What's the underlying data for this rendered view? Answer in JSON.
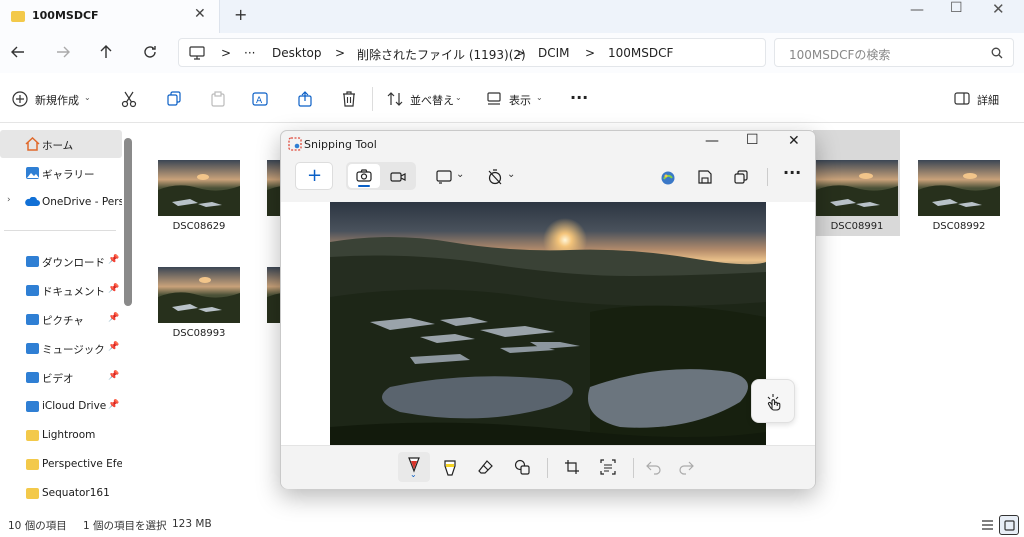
{
  "window": {
    "tab_title": "100MSDCF",
    "new_tab": "+"
  },
  "address": {
    "more": "···",
    "crumbs": [
      "Desktop",
      "削除されたファイル (1193)(2)",
      "DCIM",
      "100MSDCF"
    ],
    "separator": ">"
  },
  "search": {
    "placeholder": "100MSDCFの検索"
  },
  "toolbar": {
    "new_label": "新規作成",
    "sort_label": "並べ替え",
    "view_label": "表示",
    "more": "···",
    "details_label": "詳細"
  },
  "sidebar": {
    "home": "ホーム",
    "gallery": "ギャラリー",
    "onedrive": "OneDrive - Perso",
    "items": [
      {
        "label": "ダウンロード",
        "pinned": true
      },
      {
        "label": "ドキュメント",
        "pinned": true
      },
      {
        "label": "ピクチャ",
        "pinned": true
      },
      {
        "label": "ミュージック",
        "pinned": true
      },
      {
        "label": "ビデオ",
        "pinned": true
      },
      {
        "label": "iCloud Drive",
        "pinned": true
      },
      {
        "label": "Lightroom",
        "pinned": false
      },
      {
        "label": "Perspective Efex",
        "pinned": false
      },
      {
        "label": "Sequator161",
        "pinned": false
      }
    ]
  },
  "files": [
    {
      "name": "DSC08629"
    },
    {
      "name": "DSC08991",
      "selected": true
    },
    {
      "name": "DSC08992"
    },
    {
      "name": "DSC08993"
    }
  ],
  "status": {
    "count": "10 個の項目",
    "selection": "1 個の項目を選択",
    "size": "123 MB"
  },
  "snipping_tool": {
    "title": "Snipping Tool",
    "new_button": "+",
    "more": "···"
  },
  "colors": {
    "accent": "#0a5fc6",
    "folder": "#f3c94a",
    "selected_bg": "#d9d9d9"
  }
}
